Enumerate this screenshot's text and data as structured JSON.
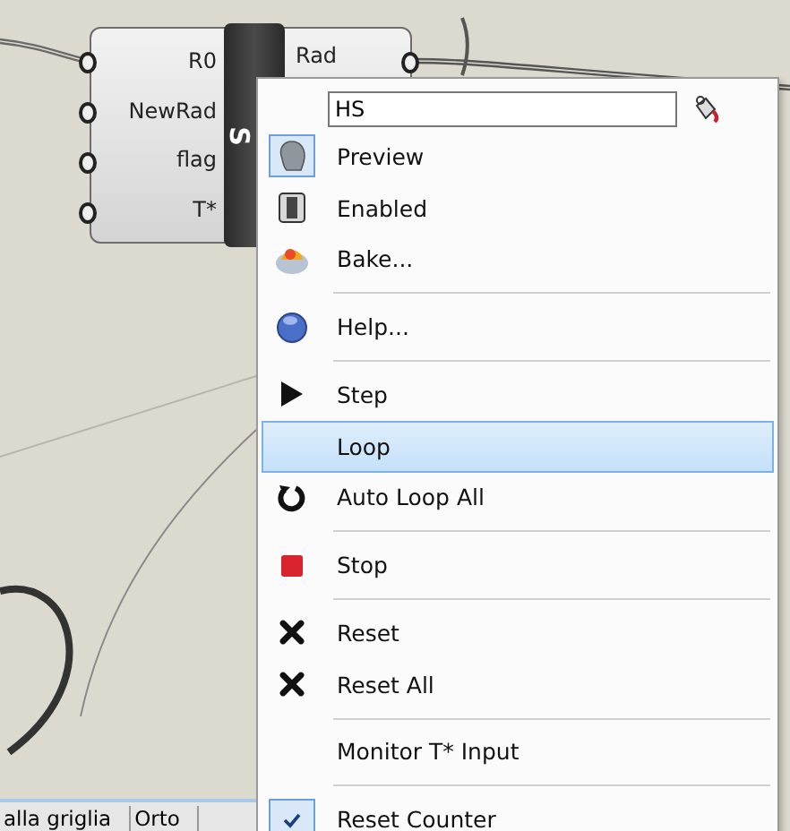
{
  "component": {
    "inputs": [
      "R0",
      "NewRad",
      "flag",
      "T*"
    ],
    "nickname": "S",
    "outputs": [
      "Rad"
    ]
  },
  "menu": {
    "name_field": {
      "value": "HS"
    },
    "items": [
      {
        "kind": "preview",
        "label": "Preview",
        "checked": true,
        "selected": false
      },
      {
        "kind": "enabled",
        "label": "Enabled",
        "checked": false,
        "selected": false
      },
      {
        "kind": "bake",
        "label": "Bake...",
        "checked": false,
        "selected": false
      },
      {
        "kind": "separator"
      },
      {
        "kind": "help",
        "label": "Help...",
        "checked": false,
        "selected": false
      },
      {
        "kind": "separator"
      },
      {
        "kind": "step",
        "label": "Step",
        "checked": false,
        "selected": false
      },
      {
        "kind": "plain",
        "label": "Loop",
        "checked": false,
        "selected": true
      },
      {
        "kind": "autoloop",
        "label": "Auto Loop All",
        "checked": false,
        "selected": false
      },
      {
        "kind": "separator"
      },
      {
        "kind": "stop",
        "label": "Stop",
        "checked": false,
        "selected": false
      },
      {
        "kind": "separator"
      },
      {
        "kind": "reset",
        "label": "Reset",
        "checked": false,
        "selected": false
      },
      {
        "kind": "reset",
        "label": "Reset All",
        "checked": false,
        "selected": false
      },
      {
        "kind": "separator"
      },
      {
        "kind": "plain",
        "label": "Monitor T* Input",
        "checked": false,
        "selected": false
      },
      {
        "kind": "separator"
      },
      {
        "kind": "plain",
        "label": "Reset Counter",
        "checked": true,
        "selected": false
      }
    ]
  },
  "status_bar": {
    "items": [
      "alla griglia",
      "Orto"
    ]
  }
}
